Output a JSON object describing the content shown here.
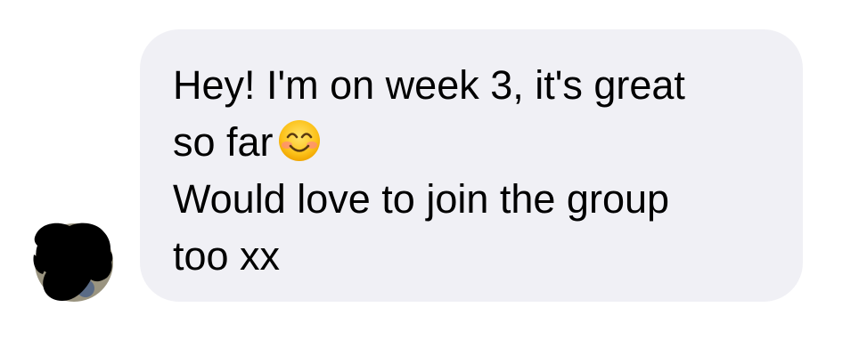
{
  "conversation": {
    "message": {
      "line_1": "Hey! I'm on week 3, it's great",
      "line_2": "so far",
      "line_3": "Would love to join the group",
      "line_4": "too xx",
      "emoji": "smiling-face-with-smiling-eyes-icon"
    }
  },
  "colors": {
    "bubble_background": "#f0f0f5",
    "text": "#000000",
    "avatar_redaction": "#000000"
  }
}
